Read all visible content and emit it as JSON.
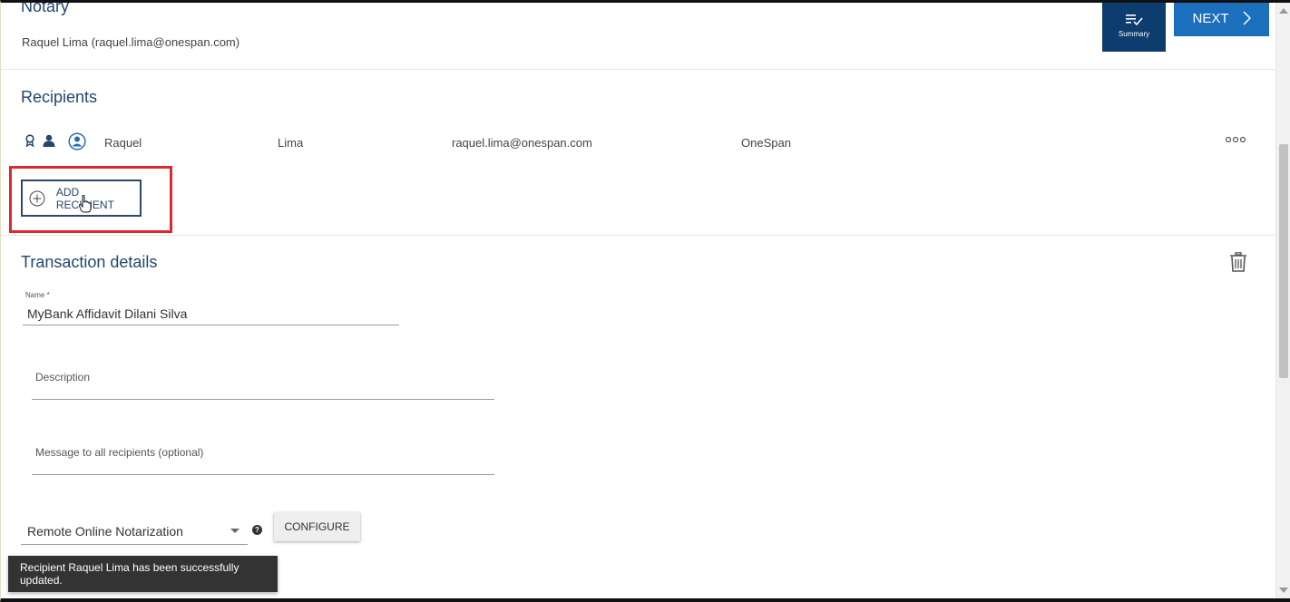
{
  "notary": {
    "title": "Notary",
    "user": "Raquel Lima (raquel.lima@onespan.com)"
  },
  "header_actions": {
    "summary_label": "Summary",
    "next_label": "NEXT"
  },
  "recipients": {
    "title": "Recipients",
    "rows": [
      {
        "first_name": "Raquel",
        "last_name": "Lima",
        "email": "raquel.lima@onespan.com",
        "company": "OneSpan",
        "icons": [
          "award-icon",
          "person-icon",
          "user-circle-icon"
        ]
      }
    ],
    "add_label": "ADD RECIPIENT"
  },
  "transaction": {
    "title": "Transaction details",
    "name_label": "Name *",
    "name_value": "MyBank Affidavit Dilani Silva",
    "description_label": "Description",
    "message_label": "Message to all recipients (optional)",
    "notarization_type": "Remote Online Notarization",
    "help_glyph": "?",
    "configure_label": "CONFIGURE"
  },
  "toast": {
    "message": "Recipient Raquel Lima has been successfully updated."
  },
  "colors": {
    "heading": "#23466e",
    "summary_bg": "#0d3c6e",
    "next_bg": "#1b6fbd",
    "highlight": "#e0262e",
    "toast_bg": "#333333"
  }
}
